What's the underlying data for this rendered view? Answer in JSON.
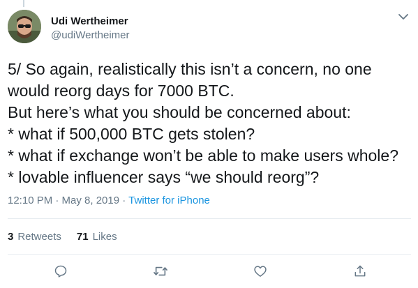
{
  "tweet": {
    "author_name": "Udi Wertheimer",
    "author_handle": "@udiWertheimer",
    "text": "5/ So again, realistically this isn’t a concern, no one would reorg days for 7000 BTC.\nBut here’s what you should be concerned about:\n* what if 500,000 BTC gets stolen?\n* what if exchange won’t be able to make users whole?\n* lovable influencer says “we should reorg”?",
    "time": "12:10 PM · May 8, 2019 · ",
    "source": "Twitter for iPhone"
  },
  "stats": {
    "retweets_count": "3",
    "retweets_label": "Retweets",
    "likes_count": "71",
    "likes_label": "Likes"
  },
  "icons": {
    "caret": "chevron-down-icon",
    "reply": "reply-icon",
    "retweet": "retweet-icon",
    "like": "heart-icon",
    "share": "share-icon"
  },
  "colors": {
    "text": "#14171a",
    "secondary": "#657786",
    "link": "#1b95e0",
    "divider": "#e6ecf0"
  }
}
